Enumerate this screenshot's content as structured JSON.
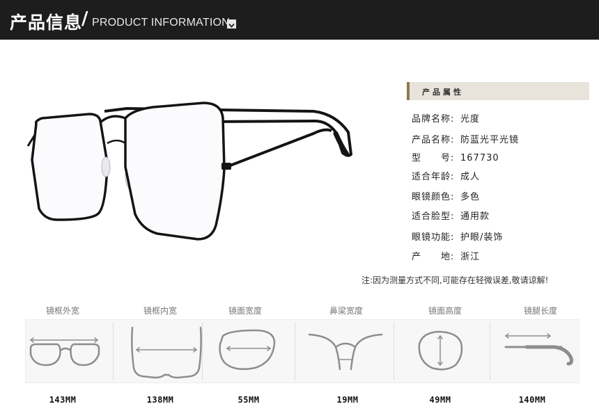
{
  "header": {
    "title_cn": "产品信息",
    "title_en": "PRODUCT INFORMATION"
  },
  "attributes": {
    "section_title": "产品属性",
    "rows": [
      {
        "key": "品牌名称:",
        "value": "光度"
      },
      {
        "key": "产品名称:",
        "value": "防蓝光平光镜"
      },
      {
        "key": "型　　号:",
        "value": "167730"
      },
      {
        "key": "适合年龄:",
        "value": "成人"
      },
      {
        "key": "眼镜颜色:",
        "value": "多色"
      },
      {
        "key": "适合脸型:",
        "value": "通用款"
      },
      {
        "key": "眼镜功能:",
        "value": "护眼/装饰"
      },
      {
        "key": "产　　地:",
        "value": "浙江"
      }
    ]
  },
  "note": "注:因为测量方式不同,可能存在轻微误差,敬请谅解!",
  "measurements": [
    {
      "label": "镜框外宽",
      "value": "143MM"
    },
    {
      "label": "镜框内宽",
      "value": "138MM"
    },
    {
      "label": "镜面宽度",
      "value": "55MM"
    },
    {
      "label": "鼻梁宽度",
      "value": "19MM"
    },
    {
      "label": "镜面高度",
      "value": "49MM"
    },
    {
      "label": "镜腿长度",
      "value": "140MM"
    }
  ],
  "icons": {
    "header": "chevron-down-icon",
    "product": "glasses-product-photo"
  },
  "colors": {
    "header_bg": "#1d1d1d",
    "accent": "#8c7a4f",
    "section_bg": "#e8e4db"
  }
}
